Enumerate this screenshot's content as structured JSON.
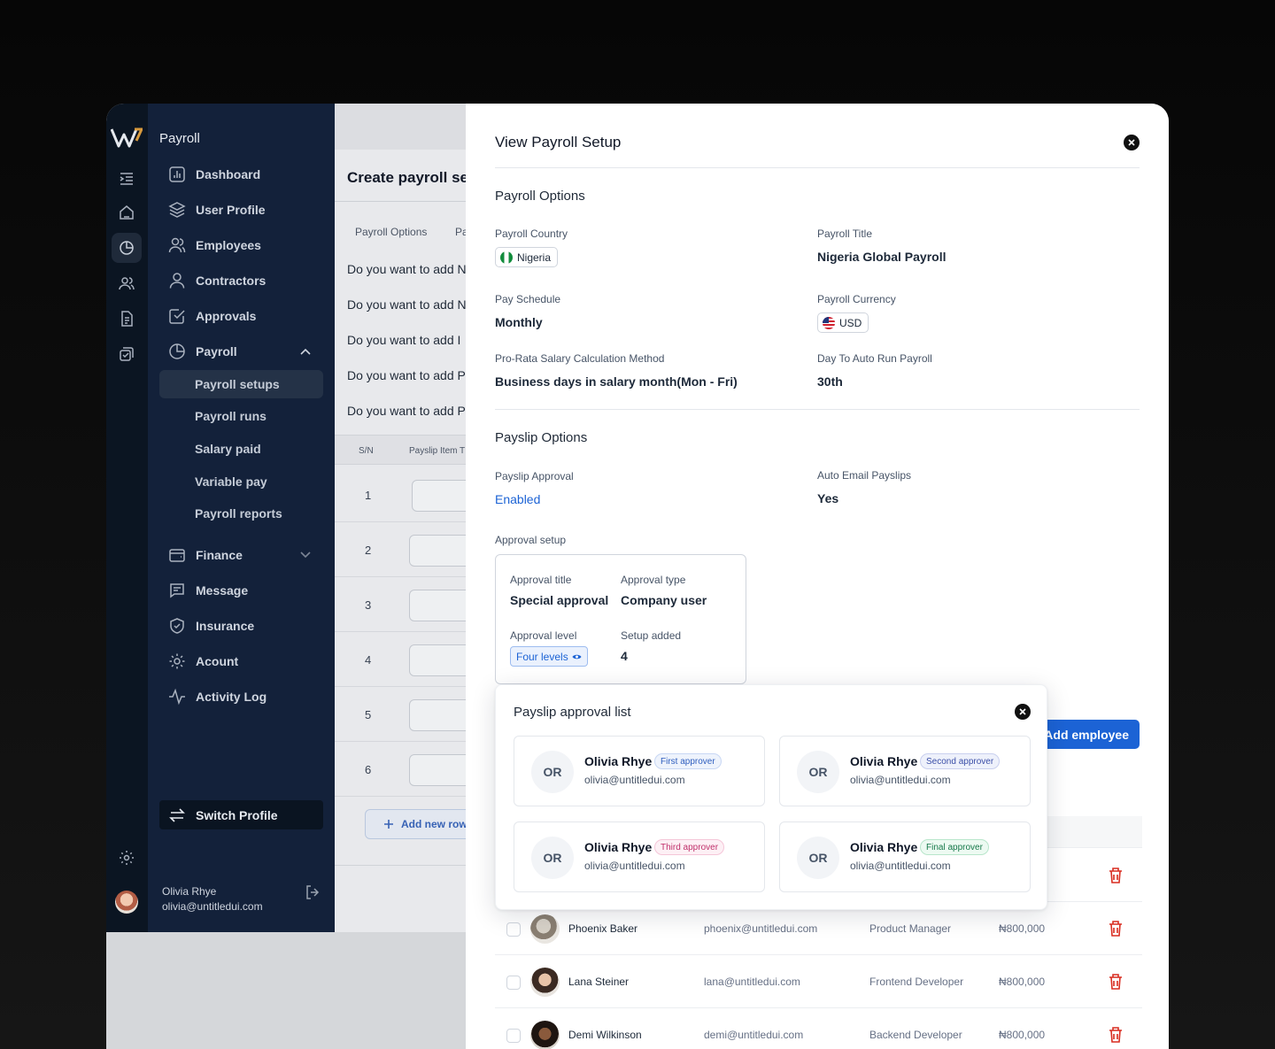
{
  "sidebar": {
    "section_title": "Payroll",
    "items": [
      {
        "label": "Dashboard"
      },
      {
        "label": "User Profile"
      },
      {
        "label": "Employees"
      },
      {
        "label": "Contractors"
      },
      {
        "label": "Approvals"
      },
      {
        "label": "Payroll"
      }
    ],
    "payroll_sub": [
      {
        "label": "Payroll setups"
      },
      {
        "label": "Payroll runs"
      },
      {
        "label": "Salary paid"
      },
      {
        "label": "Variable pay"
      },
      {
        "label": "Payroll reports"
      }
    ],
    "items2": [
      {
        "label": "Finance"
      },
      {
        "label": "Message"
      },
      {
        "label": "Insurance"
      },
      {
        "label": "Acount"
      },
      {
        "label": "Activity Log"
      }
    ],
    "switch_label": "Switch Profile",
    "user": {
      "name": "Olivia Rhye",
      "email": "olivia@untitledui.com"
    }
  },
  "background_page": {
    "title": "Create payroll se",
    "tabs": [
      "Payroll Options",
      "Pa"
    ],
    "questions": [
      "Do you want to add N",
      "Do you want to add N",
      "Do you want to add I",
      "Do you want to add P",
      "Do you want to add P"
    ],
    "table_headers": [
      "S/N",
      "Payslip Item T"
    ],
    "rows": [
      "1",
      "2",
      "3",
      "4",
      "5",
      "6"
    ],
    "add_row": "Add new row"
  },
  "modal": {
    "title": "View Payroll Setup",
    "payroll_options": {
      "heading": "Payroll Options",
      "country_label": "Payroll Country",
      "country": "Nigeria",
      "title_label": "Payroll Title",
      "title_value": "Nigeria Global Payroll",
      "schedule_label": "Pay Schedule",
      "schedule": "Monthly",
      "currency_label": "Payroll Currency",
      "currency": "USD",
      "prorata_label": "Pro-Rata Salary Calculation Method",
      "prorata": "Business days in salary month(Mon - Fri)",
      "autorun_label": "Day To Auto Run Payroll",
      "autorun": "30th"
    },
    "payslip_options": {
      "heading": "Payslip Options",
      "approval_label": "Payslip Approval",
      "approval": "Enabled",
      "auto_email_label": "Auto Email Payslips",
      "auto_email": "Yes",
      "approval_setup_label": "Approval setup",
      "setup": {
        "title_label": "Approval title",
        "title": "Special approval",
        "type_label": "Approval type",
        "type": "Company user",
        "level_label": "Approval level",
        "level": "Four levels",
        "added_label": "Setup added",
        "added": "4"
      }
    },
    "add_employee": "Add employee",
    "employees": [
      {
        "name": "Phoenix Baker",
        "email": "phoenix@untitledui.com",
        "role": "Product Manager",
        "salary": "₦800,000"
      },
      {
        "name": "Lana Steiner",
        "email": "lana@untitledui.com",
        "role": "Frontend Developer",
        "salary": "₦800,000"
      },
      {
        "name": "Demi Wilkinson",
        "email": "demi@untitledui.com",
        "role": "Backend Developer",
        "salary": "₦800,000"
      }
    ],
    "approval_list": {
      "title": "Payslip approval list",
      "approvers": [
        {
          "initials": "OR",
          "name": "Olivia Rhye",
          "email": "olivia@untitledui.com",
          "tag": "First approver"
        },
        {
          "initials": "OR",
          "name": "Olivia Rhye",
          "email": "olivia@untitledui.com",
          "tag": "Second approver"
        },
        {
          "initials": "OR",
          "name": "Olivia Rhye",
          "email": "olivia@untitledui.com",
          "tag": "Third approver"
        },
        {
          "initials": "OR",
          "name": "Olivia Rhye",
          "email": "olivia@untitledui.com",
          "tag": "Final approver"
        }
      ]
    }
  },
  "colors": {
    "accent": "#1c63d5",
    "sidebar": "#13213a",
    "rail": "#0b1522"
  }
}
